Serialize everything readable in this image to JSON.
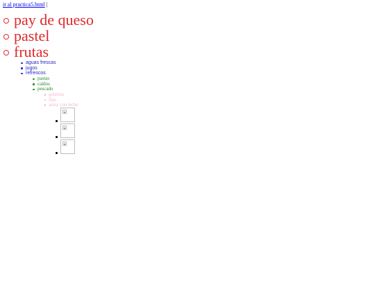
{
  "top_link": {
    "label": "ir al practica5.html",
    "separator": "|"
  },
  "level1": {
    "items": [
      {
        "label": "pay de queso"
      },
      {
        "label": "pastel"
      },
      {
        "label": "frutas"
      }
    ],
    "bullet_style": "circle",
    "color": "#e0282b"
  },
  "level2": {
    "items": [
      {
        "label": "aguas frescas"
      },
      {
        "label": "jugos"
      },
      {
        "label": "refrescos"
      }
    ],
    "bullet_style": "disc",
    "color": "#2222cc"
  },
  "level3": {
    "items": [
      {
        "label": "pastas"
      },
      {
        "label": "caldos"
      },
      {
        "label": "pescado"
      }
    ],
    "bullet_style": "disc",
    "color": "#1f8a1f"
  },
  "level4": {
    "items": [
      {
        "label": "gelatina"
      },
      {
        "label": "flan"
      },
      {
        "label": "arroz con leche"
      }
    ],
    "bullet_style": "circle",
    "color": "#f0b8c6"
  },
  "level5": {
    "items": [
      {
        "icon": "broken-image-icon"
      },
      {
        "icon": "broken-image-icon"
      },
      {
        "icon": "broken-image-icon"
      }
    ],
    "bullet_style": "disc"
  }
}
